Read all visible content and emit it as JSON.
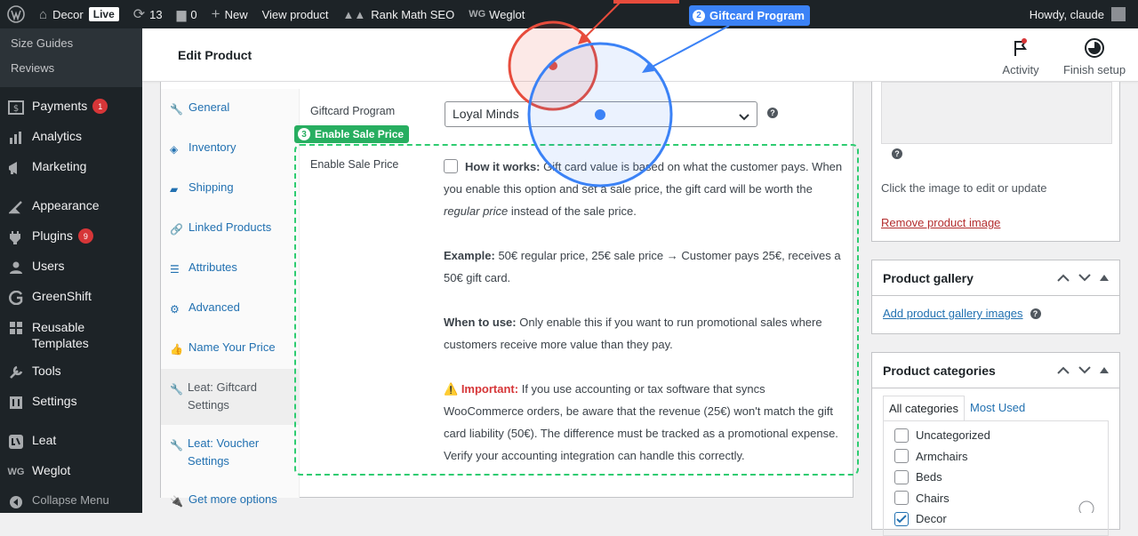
{
  "adminbar": {
    "site_name": "Decor",
    "live_label": "Live",
    "updates_count": "13",
    "comments_count": "0",
    "new_label": "New",
    "view_product_label": "View product",
    "rankmath_label": "Rank Math SEO",
    "weglot_label": "Weglot",
    "howdy_label": "Howdy, claude"
  },
  "sidebar": {
    "sub_items": [
      "Size Guides",
      "Reviews"
    ],
    "items": [
      {
        "label": "Payments",
        "badge": "1",
        "icon": "payments-icon"
      },
      {
        "label": "Analytics",
        "icon": "analytics-icon"
      },
      {
        "label": "Marketing",
        "icon": "marketing-icon"
      },
      {
        "label": "Appearance",
        "icon": "appearance-icon"
      },
      {
        "label": "Plugins",
        "badge": "9",
        "icon": "plugins-icon"
      },
      {
        "label": "Users",
        "icon": "users-icon"
      },
      {
        "label": "GreenShift",
        "icon": "greenshift-icon"
      },
      {
        "label": "Reusable Templates",
        "icon": "templates-icon"
      },
      {
        "label": "Tools",
        "icon": "tools-icon"
      },
      {
        "label": "Settings",
        "icon": "settings-icon"
      },
      {
        "label": "Leat",
        "icon": "leat-icon"
      },
      {
        "label": "Weglot",
        "icon": "weglot-icon"
      }
    ],
    "collapse_label": "Collapse Menu"
  },
  "header": {
    "title": "Edit Product",
    "activity_label": "Activity",
    "finish_setup_label": "Finish setup"
  },
  "product_tabs": [
    {
      "label": "General",
      "icon": "wrench-icon"
    },
    {
      "label": "Inventory",
      "icon": "tag-icon"
    },
    {
      "label": "Shipping",
      "icon": "truck-icon"
    },
    {
      "label": "Linked Products",
      "icon": "link-icon"
    },
    {
      "label": "Attributes",
      "icon": "list-icon"
    },
    {
      "label": "Advanced",
      "icon": "gear-icon"
    },
    {
      "label": "Name Your Price",
      "icon": "thumbs-up-icon"
    },
    {
      "label": "Leat: Giftcard Settings",
      "icon": "wrench-icon"
    },
    {
      "label": "Leat: Voucher Settings",
      "icon": "wrench-icon"
    },
    {
      "label": "Get more options",
      "icon": "plug-icon"
    }
  ],
  "giftcard": {
    "label": "Giftcard Program",
    "selected": "Loyal Minds"
  },
  "sale_price": {
    "label": "Enable Sale Price",
    "how_title": "How it works:",
    "how_text": "Gift card value is based on what the customer pays. When you enable this option and set a sale price, the gift card will be worth the",
    "how_em": "regular price",
    "how_tail": "instead of the sale price.",
    "example_title": "Example:",
    "example_text": "50€ regular price, 25€ sale price → Customer pays 25€, receives a 50€ gift card.",
    "when_title": "When to use:",
    "when_text": "Only enable this if you want to run promotional sales where customers receive more value than they pay.",
    "important_icon": "⚠️",
    "important_title": "Important:",
    "important_text": "If you use accounting or tax software that syncs WooCommerce orders, be aware that the revenue (25€) won't match the gift card liability (50€). The difference must be tracked as a promotional expense. Verify your accounting integration can handle this correctly."
  },
  "annotations": {
    "tag2_num": "2",
    "tag2_label": "Giftcard Program",
    "tag3_num": "3",
    "tag3_label": "Enable Sale Price",
    "colors": {
      "red": "#e74c3c",
      "blue": "#3b82f6",
      "green": "#27ae60"
    }
  },
  "product_image": {
    "hint": "Click the image to edit or update",
    "remove_label": "Remove product image"
  },
  "gallery": {
    "title": "Product gallery",
    "add_label": "Add product gallery images"
  },
  "categories": {
    "title": "Product categories",
    "tab_all": "All categories",
    "tab_used": "Most Used",
    "items": [
      {
        "label": "Uncategorized",
        "checked": false
      },
      {
        "label": "Armchairs",
        "checked": false
      },
      {
        "label": "Beds",
        "checked": false
      },
      {
        "label": "Chairs",
        "checked": false
      },
      {
        "label": "Decor",
        "checked": true
      }
    ]
  }
}
